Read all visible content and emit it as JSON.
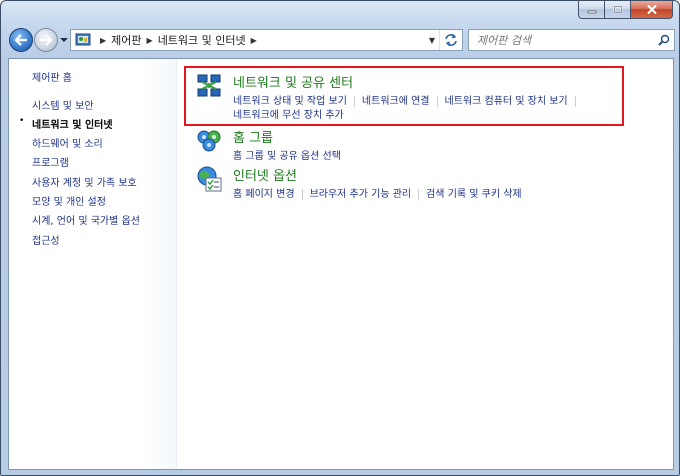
{
  "address_bar": {
    "segments": [
      "제어판",
      "네트워크 및 인터넷"
    ]
  },
  "search": {
    "placeholder": "제어판 검색"
  },
  "sidebar": {
    "items": [
      {
        "label": "제어판 홈"
      },
      {
        "label": "시스템 및 보안"
      },
      {
        "label": "네트워크 및 인터넷",
        "current": true
      },
      {
        "label": "하드웨어 및 소리"
      },
      {
        "label": "프로그램"
      },
      {
        "label": "사용자 계정 및 가족 보호"
      },
      {
        "label": "모양 및 개인 설정"
      },
      {
        "label": "시계, 언어 및 국가별 옵션"
      },
      {
        "label": "접근성"
      }
    ]
  },
  "categories": [
    {
      "title": "네트워크 및 공유 센터",
      "icon": "network-center-icon",
      "links": [
        "네트워크 상태 및 작업 보기",
        "네트워크에 연결",
        "네트워크 컴퓨터 및 장치 보기",
        "네트워크에 무선 장치 추가"
      ]
    },
    {
      "title": "홈 그룹",
      "icon": "homegroup-icon",
      "links": [
        "홈 그룹 및 공유 옵션 선택"
      ]
    },
    {
      "title": "인터넷 옵션",
      "icon": "internet-options-icon",
      "links": [
        "홈 페이지 변경",
        "브라우저 추가 기능 관리",
        "검색 기록 및 쿠키 삭제"
      ]
    }
  ],
  "colors": {
    "link": "#1e3287",
    "category_title": "#1e7b1e",
    "highlight_border": "#e4151c"
  }
}
